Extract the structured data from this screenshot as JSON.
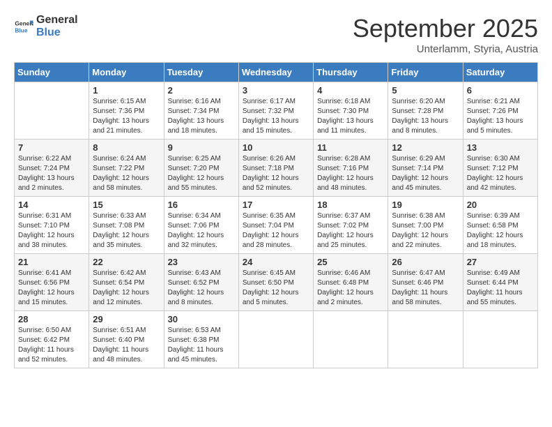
{
  "logo": {
    "text_general": "General",
    "text_blue": "Blue"
  },
  "title": "September 2025",
  "subtitle": "Unterlamm, Styria, Austria",
  "headers": [
    "Sunday",
    "Monday",
    "Tuesday",
    "Wednesday",
    "Thursday",
    "Friday",
    "Saturday"
  ],
  "weeks": [
    [
      {
        "day": "",
        "info": ""
      },
      {
        "day": "1",
        "info": "Sunrise: 6:15 AM\nSunset: 7:36 PM\nDaylight: 13 hours\nand 21 minutes."
      },
      {
        "day": "2",
        "info": "Sunrise: 6:16 AM\nSunset: 7:34 PM\nDaylight: 13 hours\nand 18 minutes."
      },
      {
        "day": "3",
        "info": "Sunrise: 6:17 AM\nSunset: 7:32 PM\nDaylight: 13 hours\nand 15 minutes."
      },
      {
        "day": "4",
        "info": "Sunrise: 6:18 AM\nSunset: 7:30 PM\nDaylight: 13 hours\nand 11 minutes."
      },
      {
        "day": "5",
        "info": "Sunrise: 6:20 AM\nSunset: 7:28 PM\nDaylight: 13 hours\nand 8 minutes."
      },
      {
        "day": "6",
        "info": "Sunrise: 6:21 AM\nSunset: 7:26 PM\nDaylight: 13 hours\nand 5 minutes."
      }
    ],
    [
      {
        "day": "7",
        "info": "Sunrise: 6:22 AM\nSunset: 7:24 PM\nDaylight: 13 hours\nand 2 minutes."
      },
      {
        "day": "8",
        "info": "Sunrise: 6:24 AM\nSunset: 7:22 PM\nDaylight: 12 hours\nand 58 minutes."
      },
      {
        "day": "9",
        "info": "Sunrise: 6:25 AM\nSunset: 7:20 PM\nDaylight: 12 hours\nand 55 minutes."
      },
      {
        "day": "10",
        "info": "Sunrise: 6:26 AM\nSunset: 7:18 PM\nDaylight: 12 hours\nand 52 minutes."
      },
      {
        "day": "11",
        "info": "Sunrise: 6:28 AM\nSunset: 7:16 PM\nDaylight: 12 hours\nand 48 minutes."
      },
      {
        "day": "12",
        "info": "Sunrise: 6:29 AM\nSunset: 7:14 PM\nDaylight: 12 hours\nand 45 minutes."
      },
      {
        "day": "13",
        "info": "Sunrise: 6:30 AM\nSunset: 7:12 PM\nDaylight: 12 hours\nand 42 minutes."
      }
    ],
    [
      {
        "day": "14",
        "info": "Sunrise: 6:31 AM\nSunset: 7:10 PM\nDaylight: 12 hours\nand 38 minutes."
      },
      {
        "day": "15",
        "info": "Sunrise: 6:33 AM\nSunset: 7:08 PM\nDaylight: 12 hours\nand 35 minutes."
      },
      {
        "day": "16",
        "info": "Sunrise: 6:34 AM\nSunset: 7:06 PM\nDaylight: 12 hours\nand 32 minutes."
      },
      {
        "day": "17",
        "info": "Sunrise: 6:35 AM\nSunset: 7:04 PM\nDaylight: 12 hours\nand 28 minutes."
      },
      {
        "day": "18",
        "info": "Sunrise: 6:37 AM\nSunset: 7:02 PM\nDaylight: 12 hours\nand 25 minutes."
      },
      {
        "day": "19",
        "info": "Sunrise: 6:38 AM\nSunset: 7:00 PM\nDaylight: 12 hours\nand 22 minutes."
      },
      {
        "day": "20",
        "info": "Sunrise: 6:39 AM\nSunset: 6:58 PM\nDaylight: 12 hours\nand 18 minutes."
      }
    ],
    [
      {
        "day": "21",
        "info": "Sunrise: 6:41 AM\nSunset: 6:56 PM\nDaylight: 12 hours\nand 15 minutes."
      },
      {
        "day": "22",
        "info": "Sunrise: 6:42 AM\nSunset: 6:54 PM\nDaylight: 12 hours\nand 12 minutes."
      },
      {
        "day": "23",
        "info": "Sunrise: 6:43 AM\nSunset: 6:52 PM\nDaylight: 12 hours\nand 8 minutes."
      },
      {
        "day": "24",
        "info": "Sunrise: 6:45 AM\nSunset: 6:50 PM\nDaylight: 12 hours\nand 5 minutes."
      },
      {
        "day": "25",
        "info": "Sunrise: 6:46 AM\nSunset: 6:48 PM\nDaylight: 12 hours\nand 2 minutes."
      },
      {
        "day": "26",
        "info": "Sunrise: 6:47 AM\nSunset: 6:46 PM\nDaylight: 11 hours\nand 58 minutes."
      },
      {
        "day": "27",
        "info": "Sunrise: 6:49 AM\nSunset: 6:44 PM\nDaylight: 11 hours\nand 55 minutes."
      }
    ],
    [
      {
        "day": "28",
        "info": "Sunrise: 6:50 AM\nSunset: 6:42 PM\nDaylight: 11 hours\nand 52 minutes."
      },
      {
        "day": "29",
        "info": "Sunrise: 6:51 AM\nSunset: 6:40 PM\nDaylight: 11 hours\nand 48 minutes."
      },
      {
        "day": "30",
        "info": "Sunrise: 6:53 AM\nSunset: 6:38 PM\nDaylight: 11 hours\nand 45 minutes."
      },
      {
        "day": "",
        "info": ""
      },
      {
        "day": "",
        "info": ""
      },
      {
        "day": "",
        "info": ""
      },
      {
        "day": "",
        "info": ""
      }
    ]
  ]
}
